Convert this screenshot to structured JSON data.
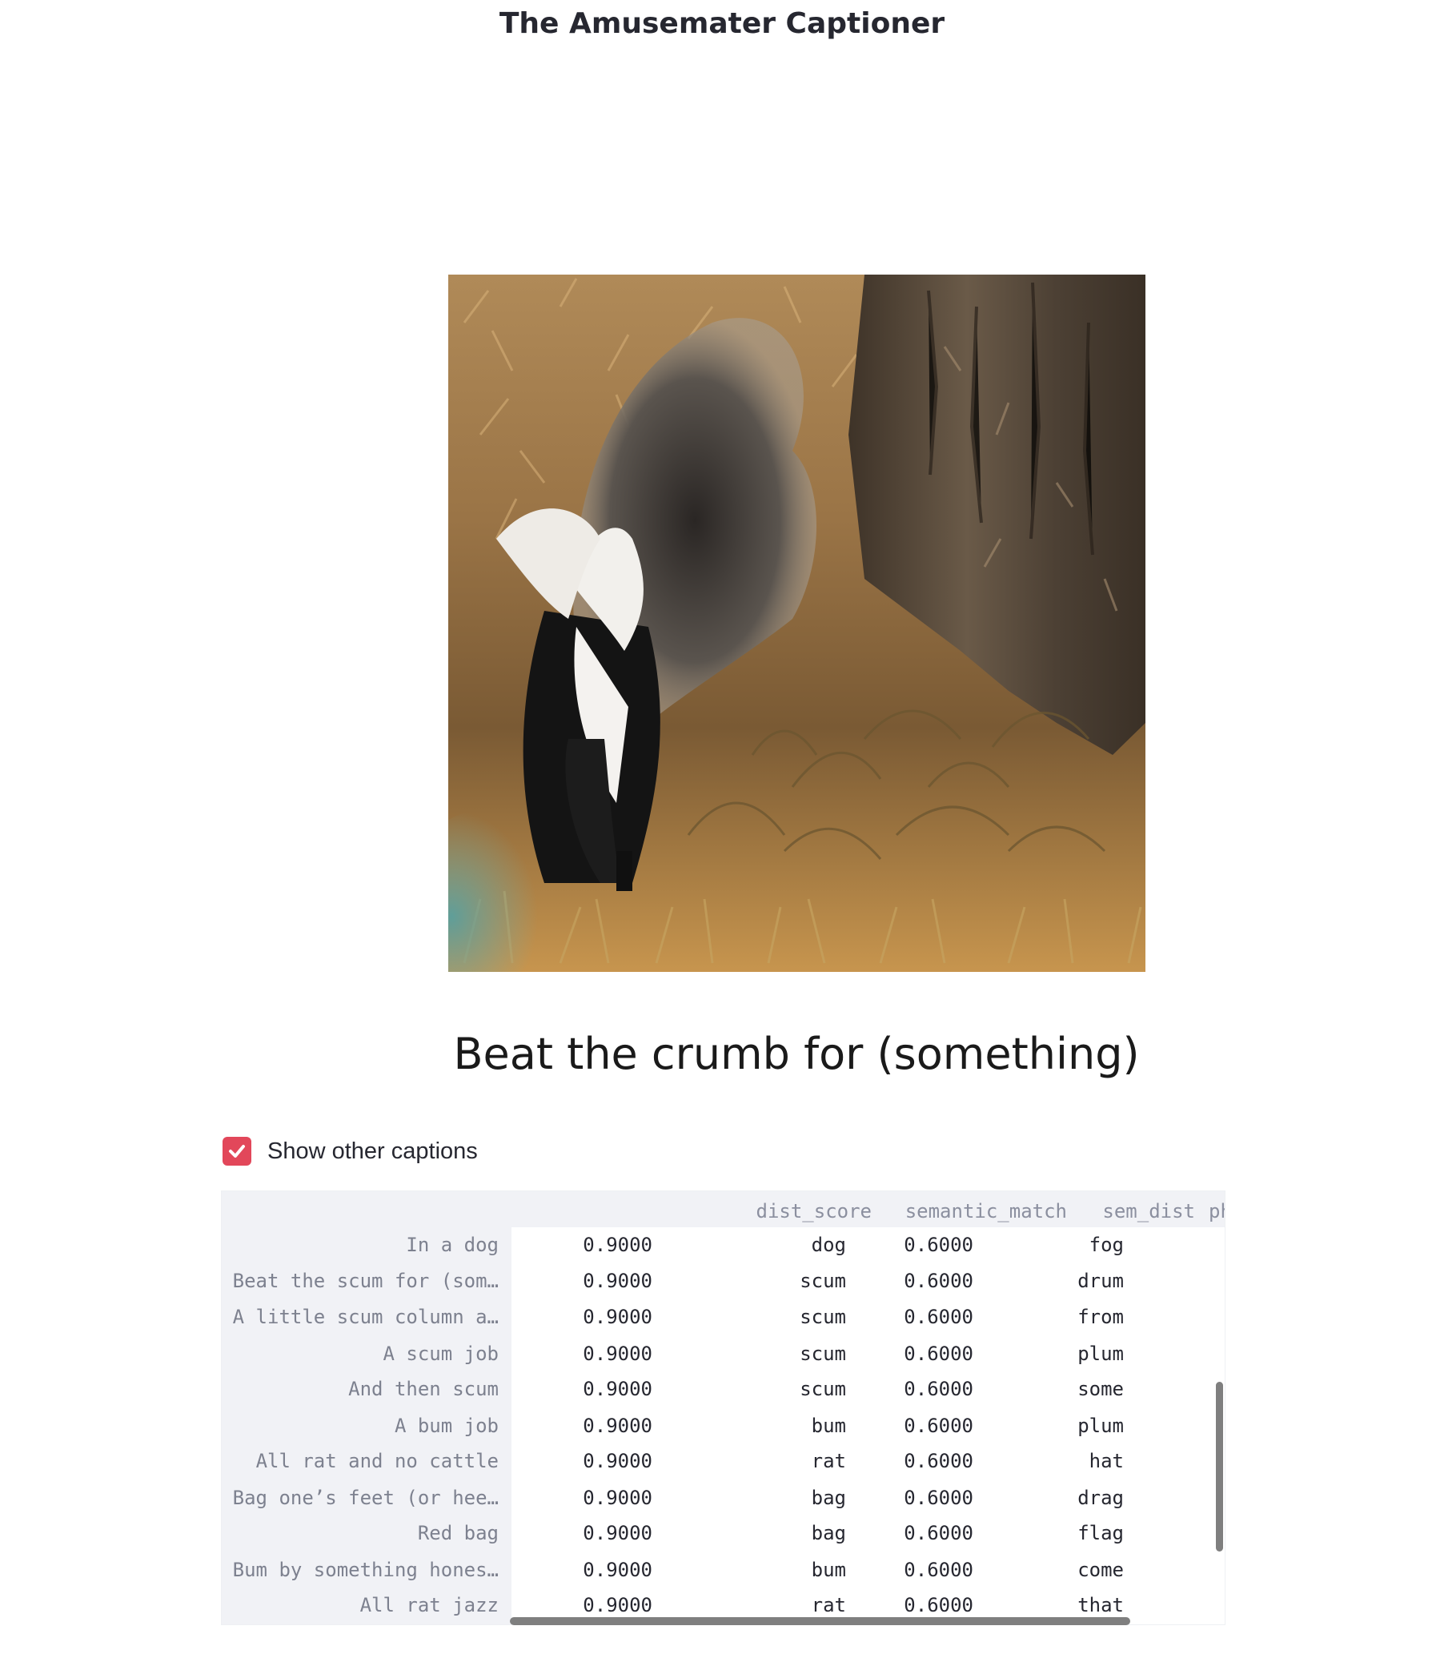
{
  "app": {
    "title": "The Amusemater Captioner"
  },
  "image": {
    "alt": "skunk next to a tree trunk in dry grass"
  },
  "caption": {
    "text": "Beat the crumb for (something)"
  },
  "toggle": {
    "label": "Show other captions",
    "checked": true,
    "accent_color": "#e2475a"
  },
  "table": {
    "columns": [
      "dist_score",
      "semantic_match",
      "sem_dist",
      "phonetic_match",
      "ph"
    ],
    "rows": [
      {
        "index": "In a dog",
        "values": [
          "0.9000",
          "dog",
          "0.6000",
          "fog"
        ]
      },
      {
        "index": "Beat the scum for (som…",
        "values": [
          "0.9000",
          "scum",
          "0.6000",
          "drum"
        ]
      },
      {
        "index": "A little scum column a…",
        "values": [
          "0.9000",
          "scum",
          "0.6000",
          "from"
        ]
      },
      {
        "index": "A scum job",
        "values": [
          "0.9000",
          "scum",
          "0.6000",
          "plum"
        ]
      },
      {
        "index": "And then scum",
        "values": [
          "0.9000",
          "scum",
          "0.6000",
          "some"
        ]
      },
      {
        "index": "A bum job",
        "values": [
          "0.9000",
          "bum",
          "0.6000",
          "plum"
        ]
      },
      {
        "index": "All rat and no cattle",
        "values": [
          "0.9000",
          "rat",
          "0.6000",
          "hat"
        ]
      },
      {
        "index": "Bag one’s feet (or hee…",
        "values": [
          "0.9000",
          "bag",
          "0.6000",
          "drag"
        ]
      },
      {
        "index": "Red bag",
        "values": [
          "0.9000",
          "bag",
          "0.6000",
          "flag"
        ]
      },
      {
        "index": "Bum by something hones…",
        "values": [
          "0.9000",
          "bum",
          "0.6000",
          "come"
        ]
      },
      {
        "index": "All rat jazz",
        "values": [
          "0.9000",
          "rat",
          "0.6000",
          "that"
        ]
      }
    ]
  }
}
